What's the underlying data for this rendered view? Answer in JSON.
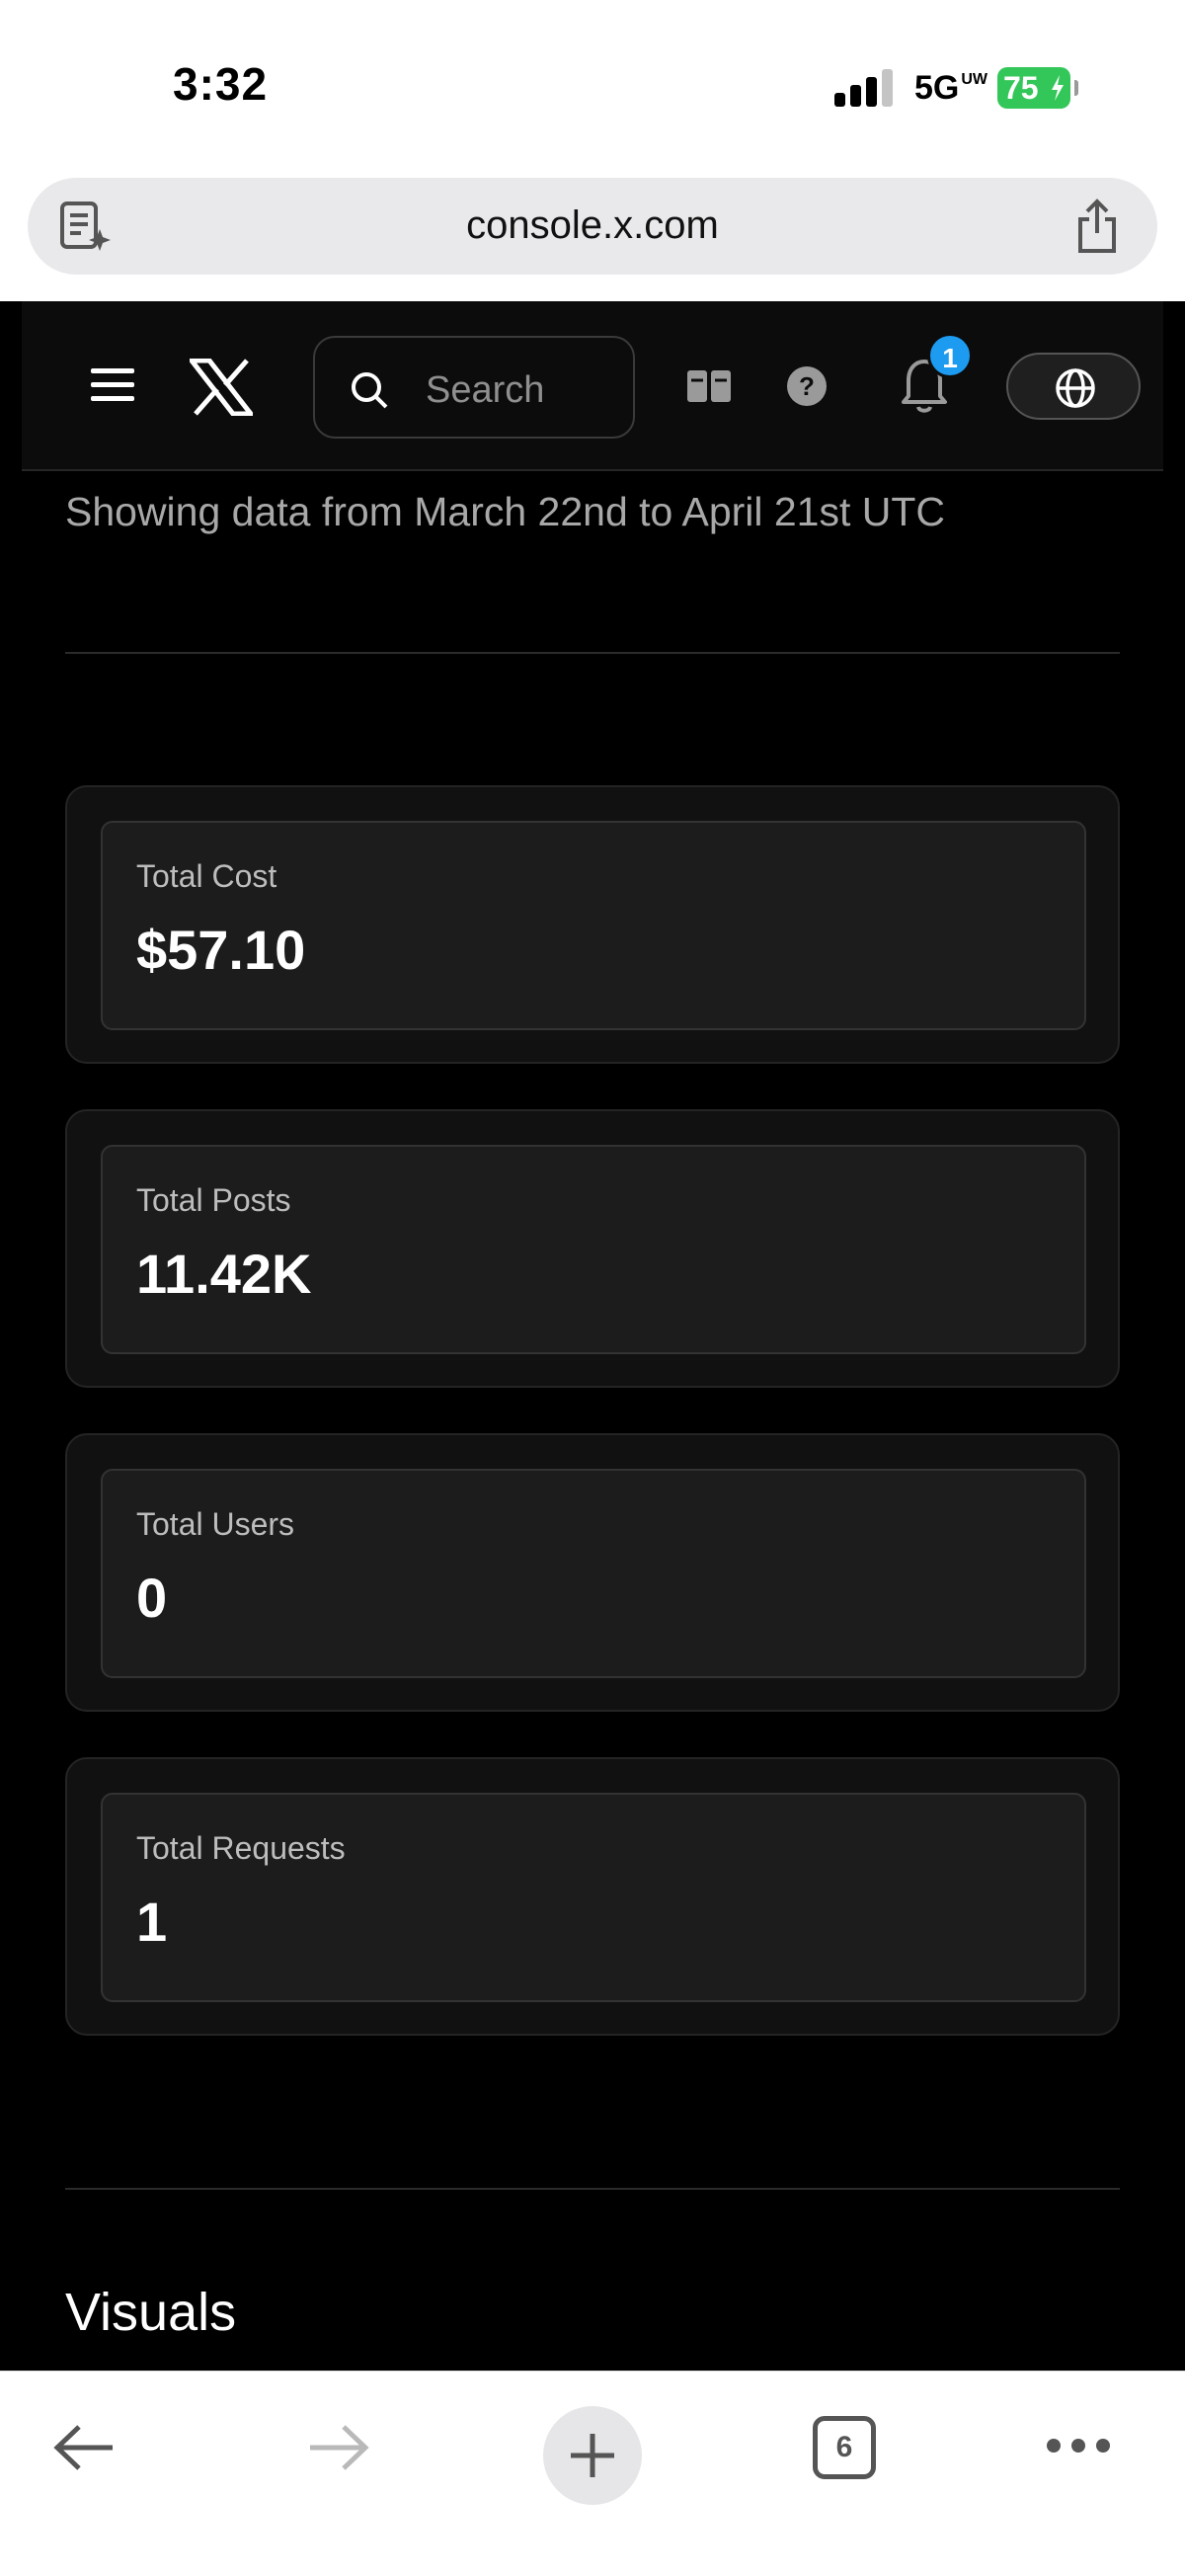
{
  "status_bar": {
    "time": "3:32",
    "network": "5G",
    "network_suffix": "UW",
    "battery": "75"
  },
  "browser": {
    "url": "console.x.com",
    "tab_count": "6"
  },
  "header": {
    "search_placeholder": "Search",
    "notification_count": "1"
  },
  "date_range": "Showing data from March 22nd to April 21st UTC",
  "stats": [
    {
      "label": "Total Cost",
      "value": "$57.10"
    },
    {
      "label": "Total Posts",
      "value": "11.42K"
    },
    {
      "label": "Total Users",
      "value": "0"
    },
    {
      "label": "Total Requests",
      "value": "1"
    }
  ],
  "section_title": "Visuals",
  "icons": {
    "reader": "reader-mode-icon",
    "share": "share-icon",
    "menu": "hamburger-menu-icon",
    "logo": "x-logo",
    "search": "search-icon",
    "docs": "docs-book-icon",
    "help": "help-icon",
    "bell": "bell-icon",
    "globe": "globe-icon",
    "back": "back-arrow-icon",
    "forward": "forward-arrow-icon",
    "new_tab": "plus-icon",
    "more": "more-icon"
  },
  "colors": {
    "accent": "#1d9bf0",
    "battery": "#33c759",
    "background": "#000000",
    "card": "#1c1c1c"
  }
}
